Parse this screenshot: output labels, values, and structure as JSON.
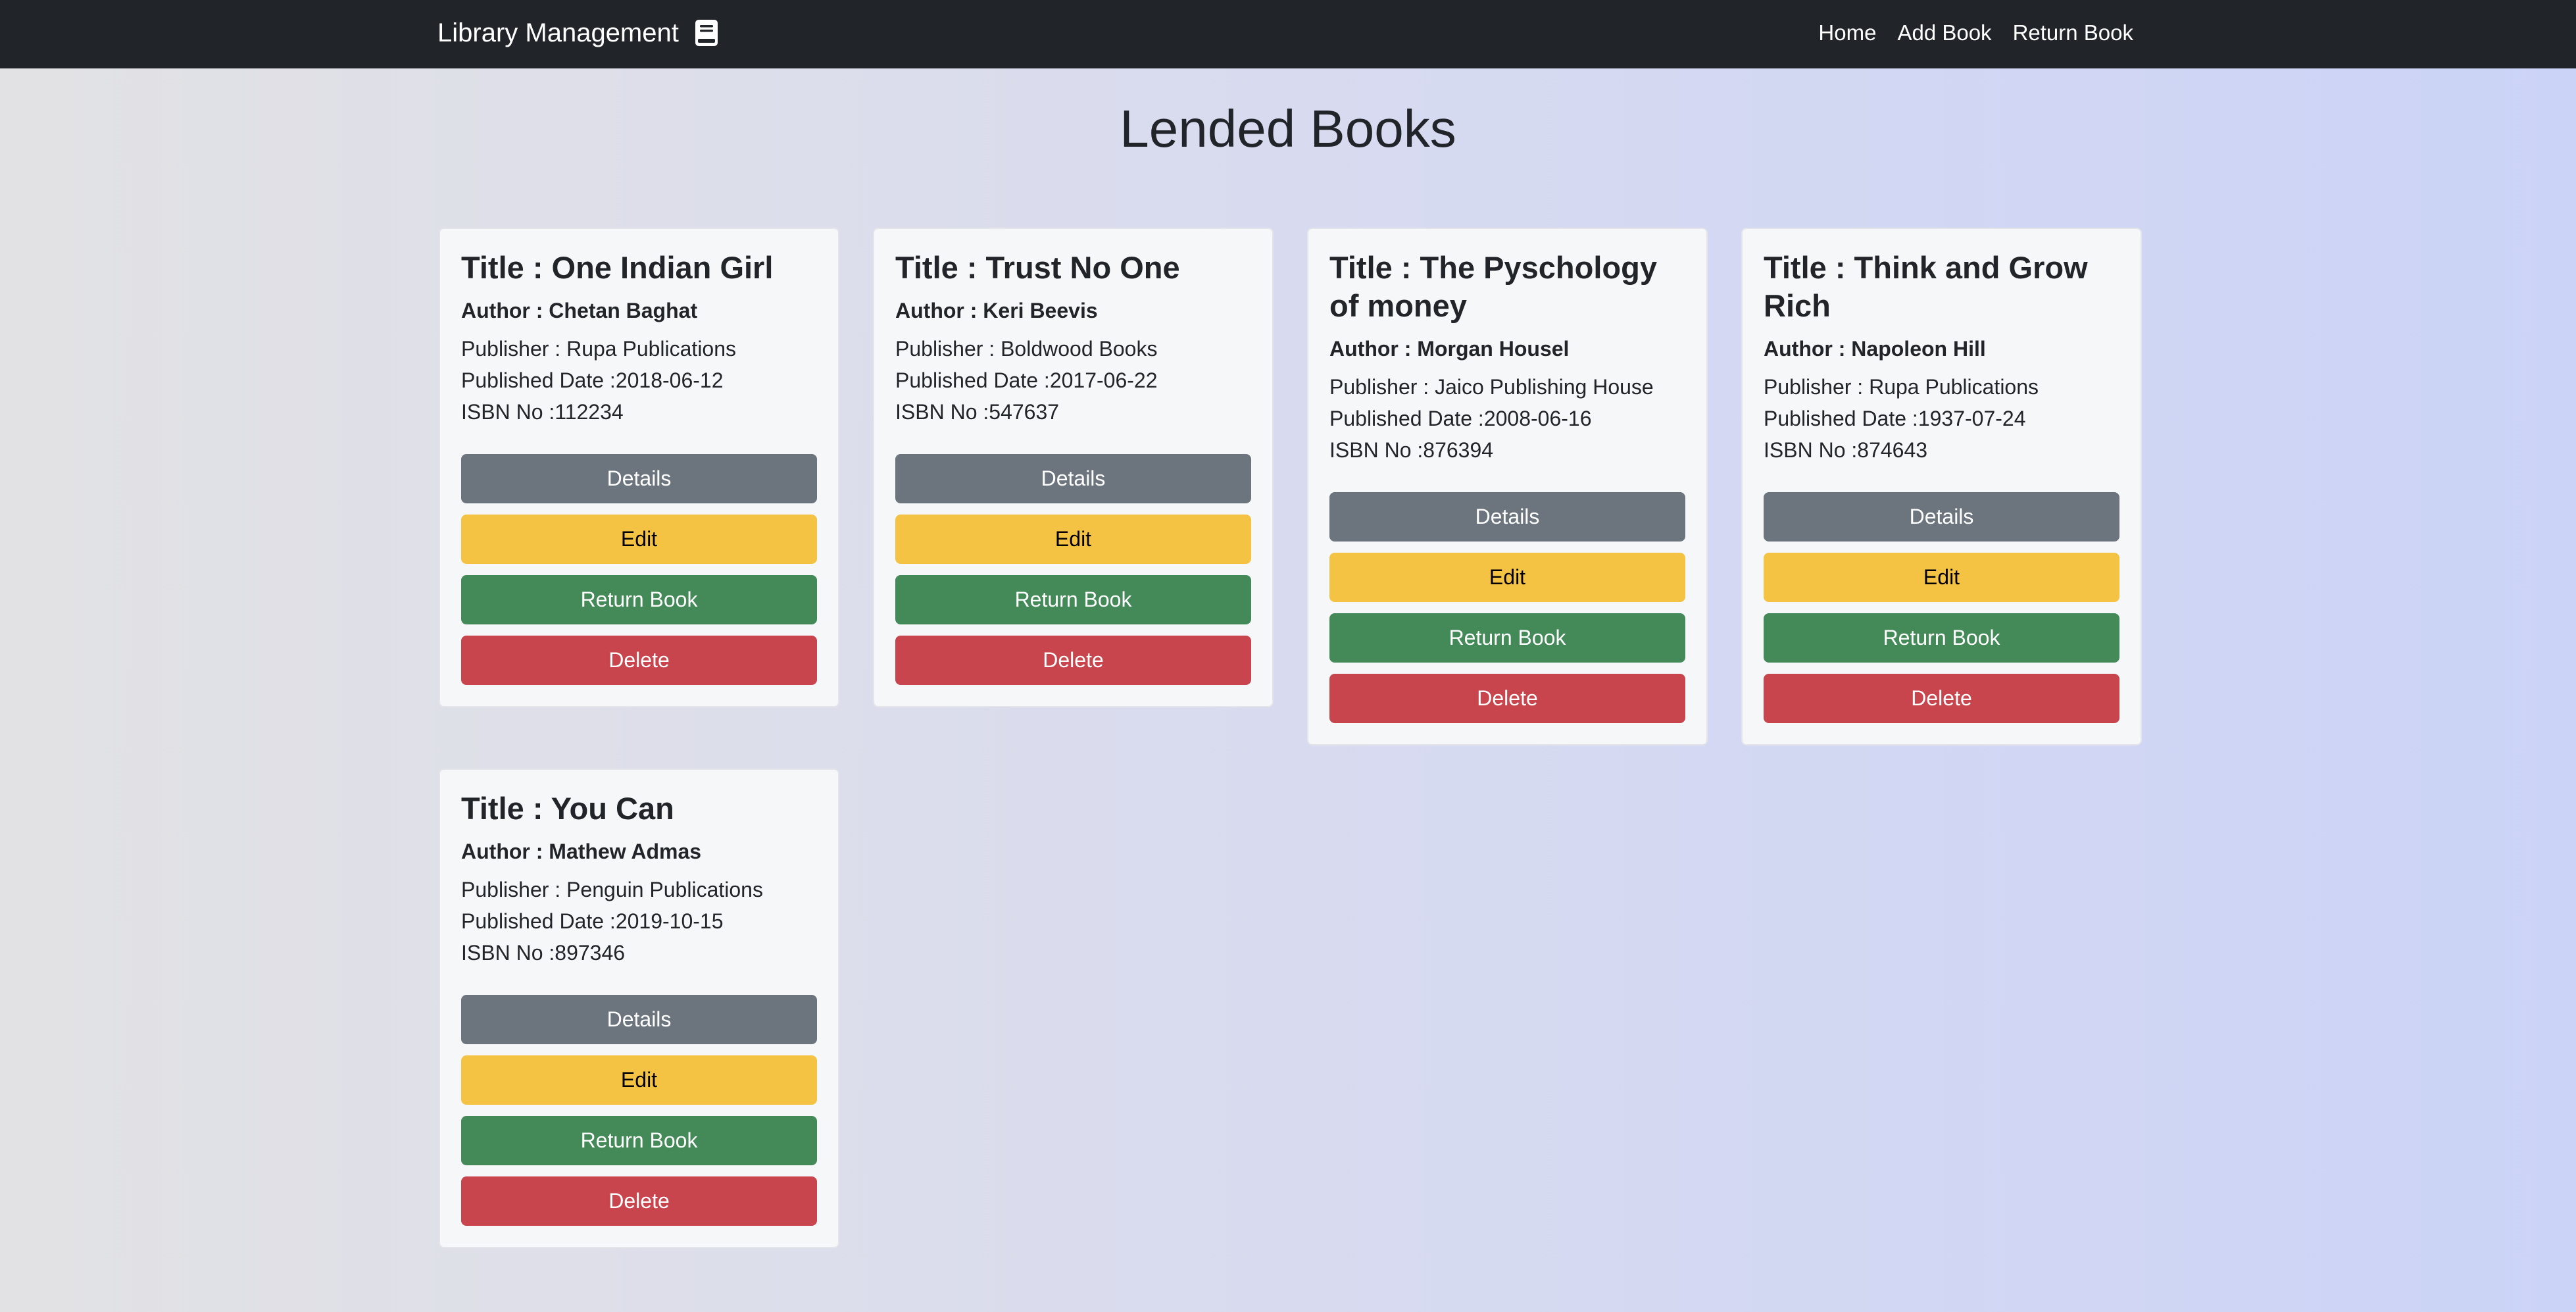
{
  "navbar": {
    "brand": "Library Management",
    "brand_icon": "book-icon",
    "links": [
      "Home",
      "Add Book",
      "Return Book"
    ]
  },
  "page_title": "Lended Books",
  "labels": {
    "details": "Details",
    "edit": "Edit",
    "return": "Return Book",
    "delete": "Delete"
  },
  "books": [
    {
      "title": "Title : One Indian Girl",
      "author": "Author : Chetan Baghat",
      "publisher": "Publisher : Rupa Publications",
      "date": "Published Date :2018-06-12",
      "isbn": "ISBN No :112234"
    },
    {
      "title": "Title : Trust No One",
      "author": "Author : Keri Beevis",
      "publisher": "Publisher : Boldwood Books",
      "date": "Published Date :2017-06-22",
      "isbn": "ISBN No :547637"
    },
    {
      "title": "Title : The Pyschology of money",
      "author": "Author : Morgan Housel",
      "publisher": "Publisher : Jaico Publishing House",
      "date": "Published Date :2008-06-16",
      "isbn": "ISBN No :876394"
    },
    {
      "title": "Title : Think and Grow Rich",
      "author": "Author : Napoleon Hill",
      "publisher": "Publisher : Rupa Publications",
      "date": "Published Date :1937-07-24",
      "isbn": "ISBN No :874643"
    },
    {
      "title": "Title : You Can",
      "author": "Author : Mathew Admas",
      "publisher": "Publisher : Penguin Publications",
      "date": "Published Date :2019-10-15",
      "isbn": "ISBN No :897346"
    }
  ],
  "colors": {
    "navbar": "#212529",
    "details": "#6c757d",
    "edit": "#f5c343",
    "return": "#438a58",
    "delete": "#c9454d"
  }
}
